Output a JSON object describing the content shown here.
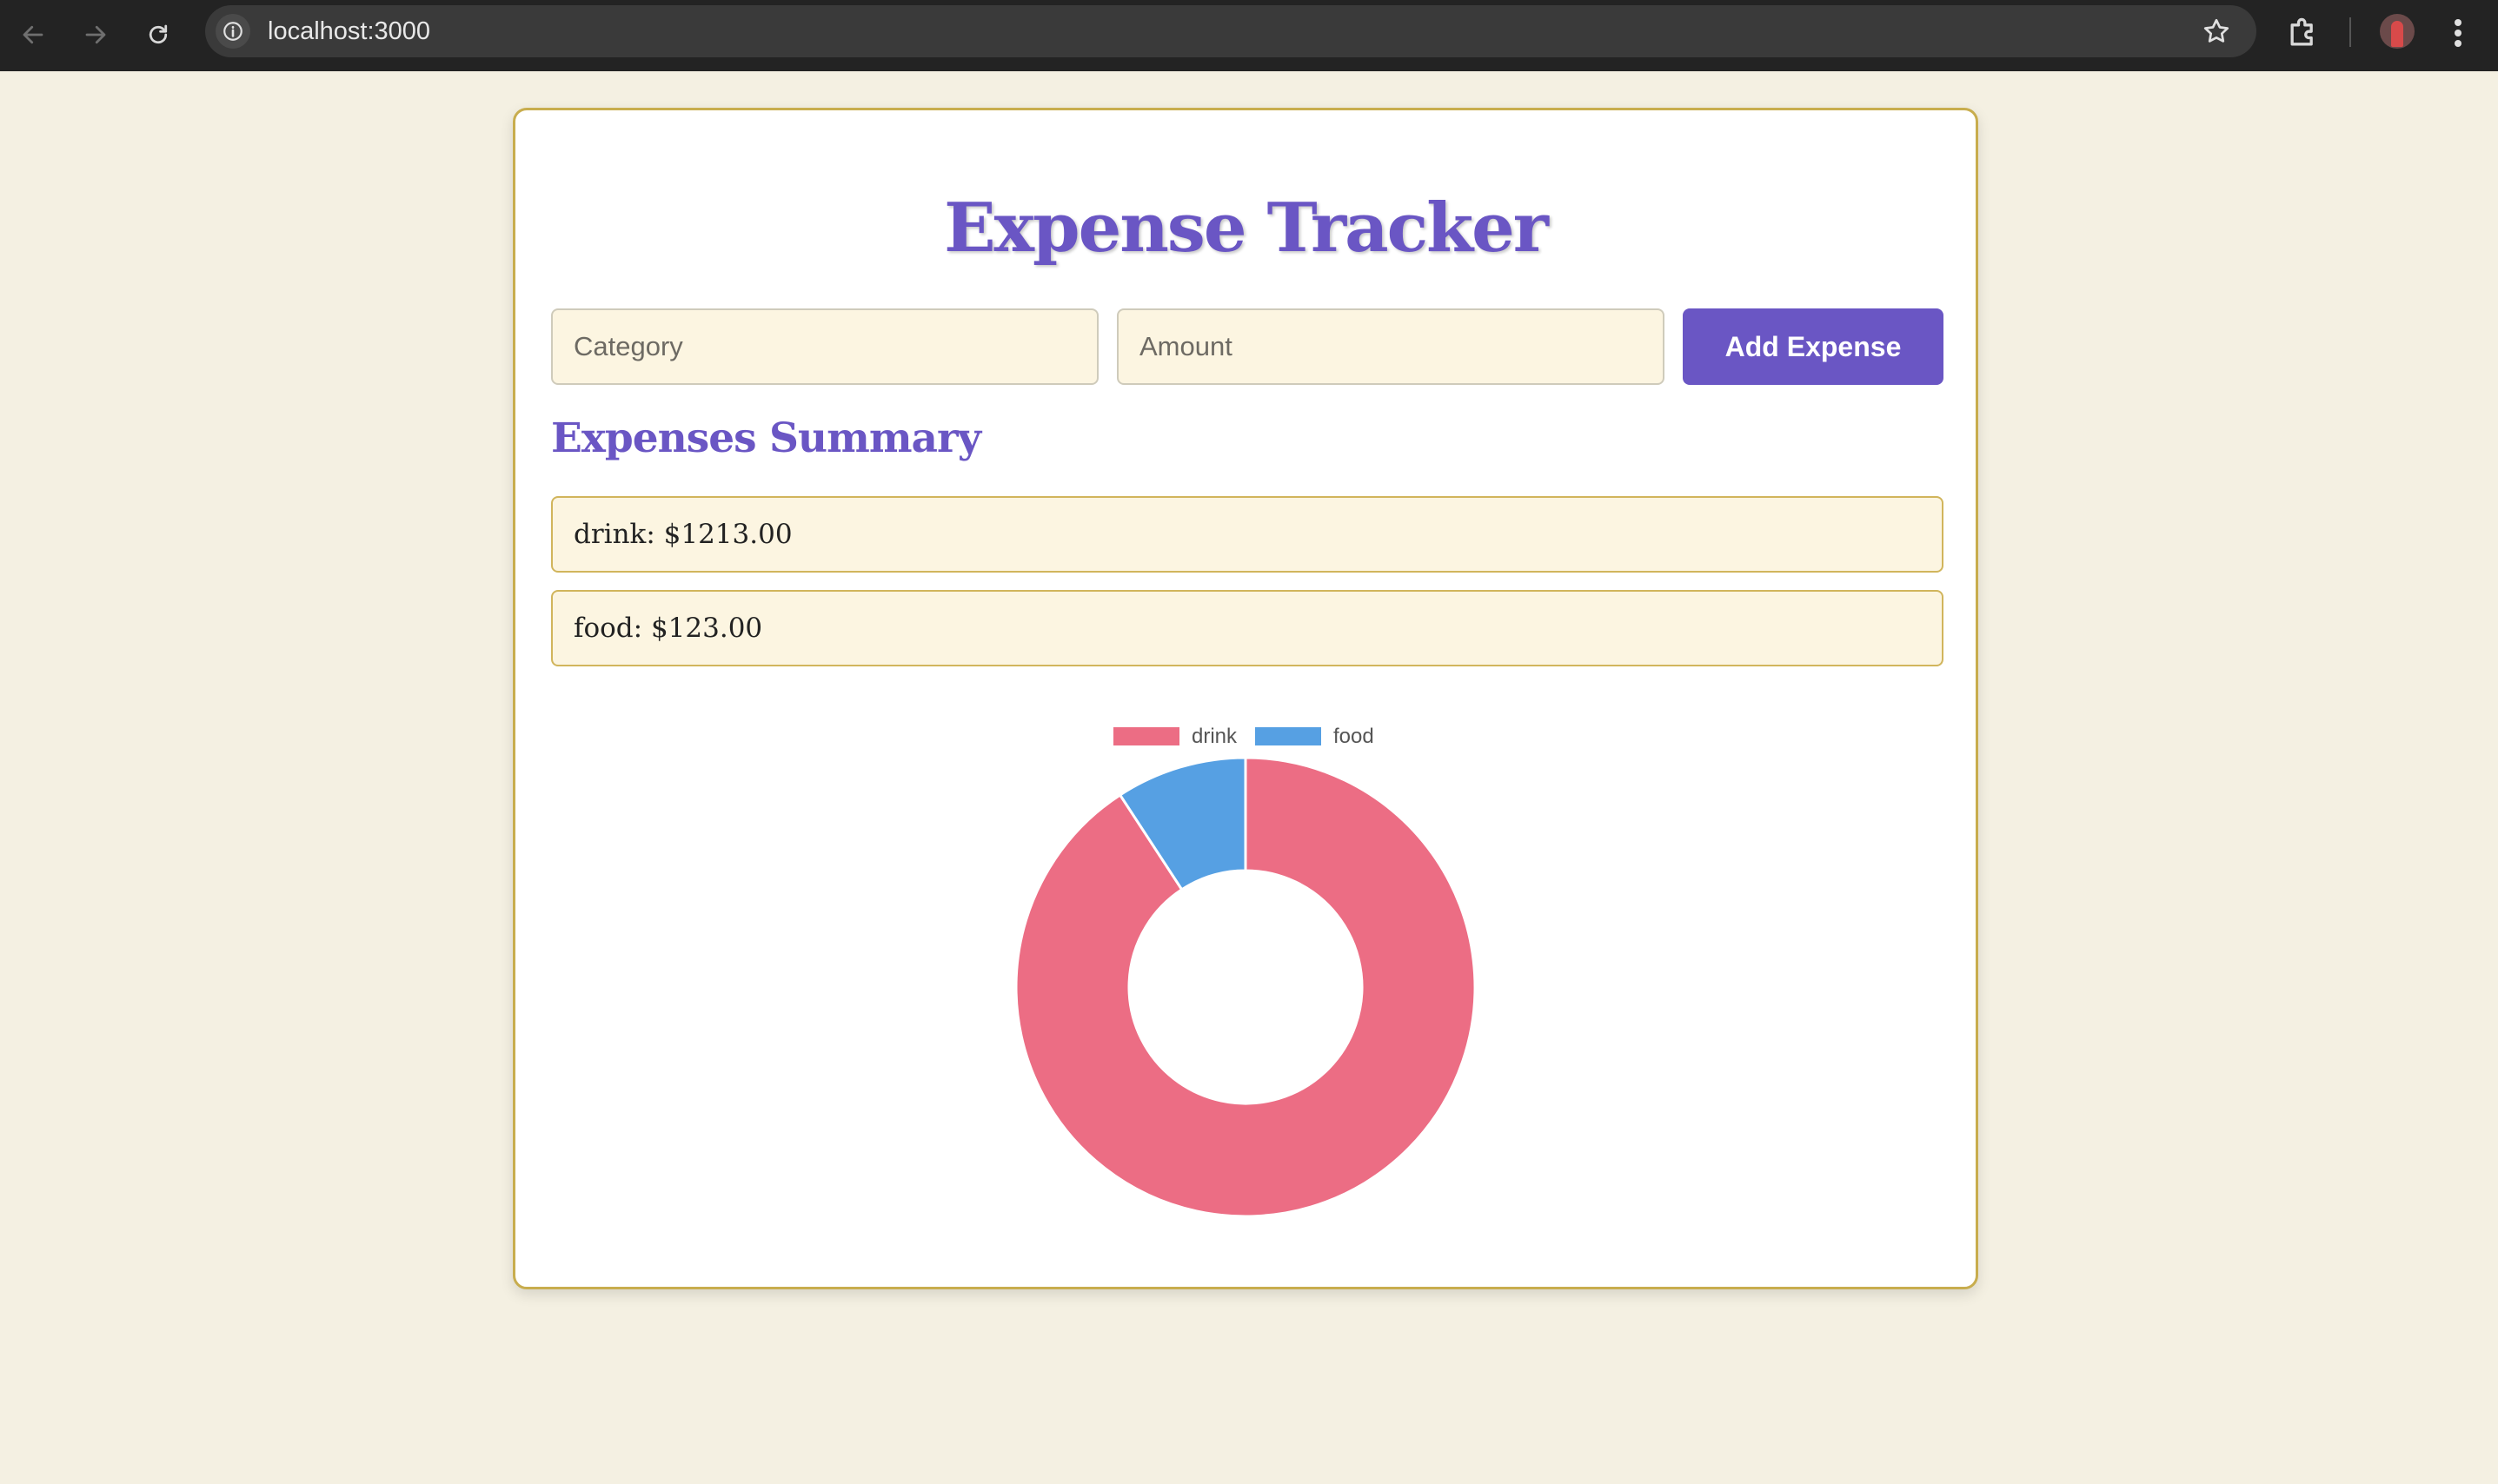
{
  "browser": {
    "url": "localhost:3000"
  },
  "app": {
    "title": "Expense Tracker",
    "category_placeholder": "Category",
    "amount_placeholder": "Amount",
    "add_button_label": "Add Expense",
    "summary_heading": "Expenses Summary",
    "expenses": [
      {
        "text": "drink: $1213.00"
      },
      {
        "text": "food: $123.00"
      }
    ]
  },
  "colors": {
    "accent": "#6a56c4",
    "drink": "#ec6d84",
    "food": "#56a0e3"
  },
  "chart_data": {
    "type": "doughnut",
    "labels": [
      "drink",
      "food"
    ],
    "values": [
      1213,
      123
    ],
    "legend": "top",
    "colors": [
      "#ec6d84",
      "#56a0e3"
    ]
  }
}
